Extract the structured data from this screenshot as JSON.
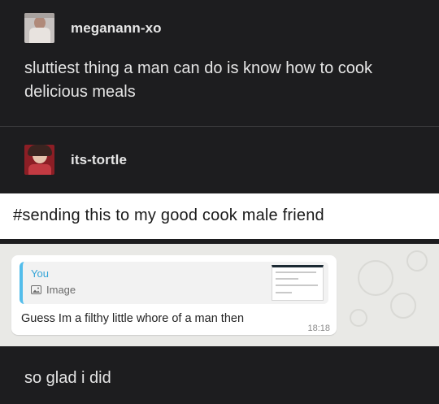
{
  "posts": [
    {
      "username": "meganann-xo",
      "text": "sluttiest thing a man can do is know how to cook delicious meals"
    },
    {
      "username": "its-tortle",
      "tag_text": "#sending this to my good cook male friend",
      "chat": {
        "quote_author": "You",
        "quote_type": "Image",
        "message": "Guess Im a filthy little whore of a man then",
        "time": "18:18"
      },
      "text": "so glad i did"
    }
  ],
  "icons": {
    "image": "image-icon"
  },
  "colors": {
    "background": "#1d1d1f",
    "quote_accent": "#53bdeb",
    "quote_author": "#35a5d8"
  }
}
